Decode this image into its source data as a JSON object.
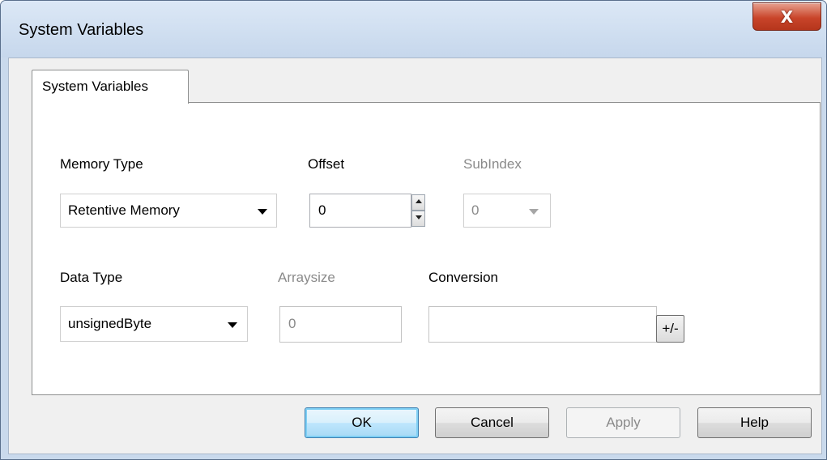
{
  "window": {
    "title": "System Variables",
    "close_glyph": "X"
  },
  "tab": {
    "label": "System Variables"
  },
  "fields": {
    "memory_type": {
      "label": "Memory Type",
      "value": "Retentive Memory"
    },
    "offset": {
      "label": "Offset",
      "value": "0"
    },
    "subindex": {
      "label": "SubIndex",
      "value": "0"
    },
    "data_type": {
      "label": "Data Type",
      "value": "unsignedByte"
    },
    "arraysize": {
      "label": "Arraysize",
      "value": "0"
    },
    "conversion": {
      "label": "Conversion",
      "value": "",
      "toggle_label": "+/-"
    }
  },
  "buttons": {
    "ok": "OK",
    "cancel": "Cancel",
    "apply": "Apply",
    "help": "Help"
  },
  "icons": {
    "close": "close-icon",
    "dropdown": "chevron-down-icon",
    "spin_up": "arrow-up-icon",
    "spin_down": "arrow-down-icon"
  },
  "colors": {
    "title_bar": "#c9d9ec",
    "close_button": "#c9452a",
    "default_button_border": "#3c7fb1"
  }
}
